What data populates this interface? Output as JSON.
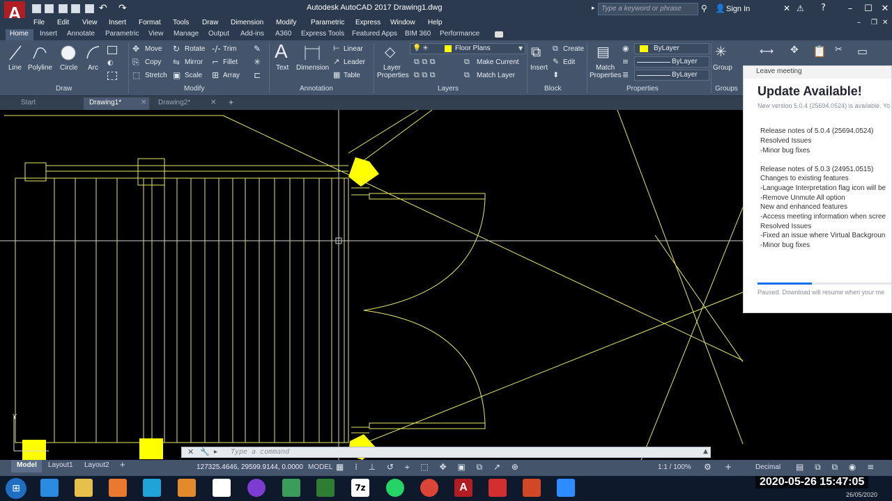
{
  "window": {
    "title": "Autodesk AutoCAD 2017    Drawing1.dwg",
    "search_placeholder": "Type a keyword or phrase",
    "signin": "Sign In",
    "logo_letter": "A"
  },
  "menus": [
    "File",
    "Edit",
    "View",
    "Insert",
    "Format",
    "Tools",
    "Draw",
    "Dimension",
    "Modify",
    "Parametric",
    "Express",
    "Window",
    "Help"
  ],
  "ribbon_tabs": [
    "Home",
    "Insert",
    "Annotate",
    "Parametric",
    "View",
    "Manage",
    "Output",
    "Add-ins",
    "A360",
    "Express Tools",
    "Featured Apps",
    "BIM 360",
    "Performance"
  ],
  "ribbon": {
    "draw": {
      "title": "Draw",
      "line": "Line",
      "polyline": "Polyline",
      "circle": "Circle",
      "arc": "Arc"
    },
    "modify": {
      "title": "Modify",
      "move": "Move",
      "copy": "Copy",
      "stretch": "Stretch",
      "rotate": "Rotate",
      "mirror": "Mirror",
      "scale": "Scale",
      "trim": "Trim",
      "fillet": "Fillet",
      "array": "Array"
    },
    "annotation": {
      "title": "Annotation",
      "text": "Text",
      "dimension": "Dimension",
      "linear": "Linear",
      "leader": "Leader",
      "table": "Table"
    },
    "layers": {
      "title": "Layers",
      "layer_properties_1": "Layer",
      "layer_properties_2": "Properties",
      "current_layer": "Floor Plans",
      "make_current": "Make Current",
      "match_layer": "Match Layer"
    },
    "block": {
      "title": "Block",
      "insert": "Insert",
      "create": "Create",
      "edit": "Edit"
    },
    "properties": {
      "title": "Properties",
      "match_1": "Match",
      "match_2": "Properties",
      "color": "ByLayer",
      "linetype": "ByLayer",
      "lineweight": "ByLayer"
    },
    "groups": {
      "title": "Groups",
      "group": "Group"
    }
  },
  "doc_tabs": [
    "Start",
    "Drawing1*",
    "Drawing2*"
  ],
  "command_placeholder": "Type a command",
  "status": {
    "coords": "127325.4646, 29599.9144, 0.0000",
    "model": "MODEL",
    "scale": "1:1 / 100%",
    "units": "Decimal",
    "layout_tabs": [
      "Model",
      "Layout1",
      "Layout2"
    ]
  },
  "zoom_popup": {
    "header": "Leave meeting",
    "title": "Update Available!",
    "version": "New version 5.0.4 (25694.0524) is available. Yo",
    "notes": [
      "Release notes of 5.0.4 (25694.0524)",
      "Resolved Issues",
      "-Minor bug fixes",
      "",
      "Release notes of 5.0.3 (24951.0515)",
      "Changes to existing features",
      "-Language Interpretation flag icon will be",
      "-Remove Unmute All option",
      "New and enhanced features",
      "-Access meeting information when scree",
      "Resolved Issues",
      "-Fixed an issue where Virtual Backgroun",
      "-Minor bug fixes"
    ],
    "progress": 0.4,
    "paused": "Paused. Download will resume when your me"
  },
  "clock": {
    "time": "2020-05-26  15:47:05",
    "date": "26/05/2020"
  },
  "colors": {
    "accent_blue": "#0e71eb",
    "drawing_yellow": "#e8e86a",
    "ribbon": "#44546a"
  }
}
